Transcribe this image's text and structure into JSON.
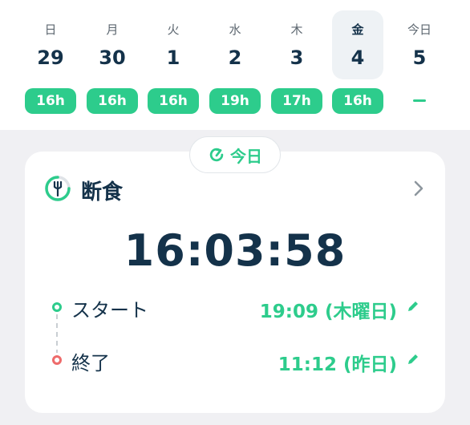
{
  "week": [
    {
      "weekday": "日",
      "date": "29",
      "hours": "16h"
    },
    {
      "weekday": "月",
      "date": "30",
      "hours": "16h"
    },
    {
      "weekday": "火",
      "date": "1",
      "hours": "16h"
    },
    {
      "weekday": "水",
      "date": "2",
      "hours": "19h"
    },
    {
      "weekday": "木",
      "date": "3",
      "hours": "17h"
    },
    {
      "weekday": "金",
      "date": "4",
      "hours": "16h",
      "selected": true
    },
    {
      "weekday": "今日",
      "date": "5",
      "hours": "–"
    }
  ],
  "today_button": {
    "label": "今日",
    "icon": "refresh-icon"
  },
  "fasting_card": {
    "title": "断食",
    "icon": "fork-progress-icon",
    "timer": "16:03:58",
    "start": {
      "label": "スタート",
      "value": "19:09 (木曜日)",
      "icon": "pencil-icon"
    },
    "end": {
      "label": "終了",
      "value": "11:12 (昨日)",
      "icon": "pencil-icon"
    }
  },
  "colors": {
    "accent": "#2dcc8c",
    "text": "#14324a",
    "end_marker": "#ee6b6b",
    "background": "#f0f0f3"
  }
}
